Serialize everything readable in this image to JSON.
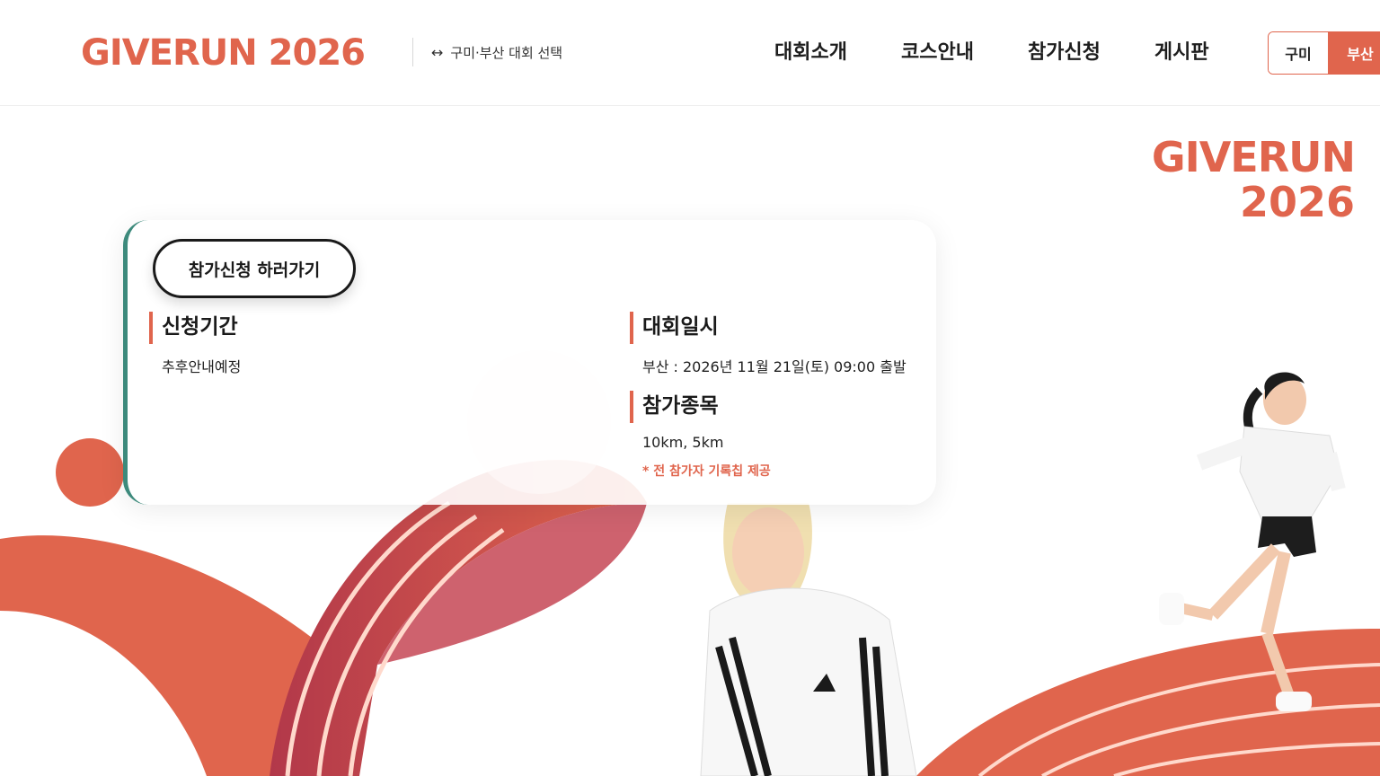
{
  "header": {
    "logo": "GIVERUN 2026",
    "selector_label": "구미·부산 대회 선택",
    "nav": [
      "대회소개",
      "코스안내",
      "참가신청",
      "게시판"
    ],
    "region_toggle": {
      "left": "구미",
      "right": "부산"
    }
  },
  "hero": {
    "logo_line1": "GIVERUN",
    "logo_line2": "2026"
  },
  "card": {
    "apply_button": "참가신청 하러가기",
    "period_title": "신청기간",
    "period_text": "추후안내예정",
    "date_title": "대회일시",
    "date_text": "부산 : 2026년 11월 21일(토) 09:00 출발",
    "events_title": "참가종목",
    "events_text": "10km, 5km",
    "events_note": "* 전 참가자 기록칩 제공"
  },
  "colors": {
    "accent": "#e0654d",
    "teal": "#3d8a7c",
    "dark_red": "#b2384a"
  },
  "icons": {
    "selector": "left-right-arrow-icon"
  }
}
